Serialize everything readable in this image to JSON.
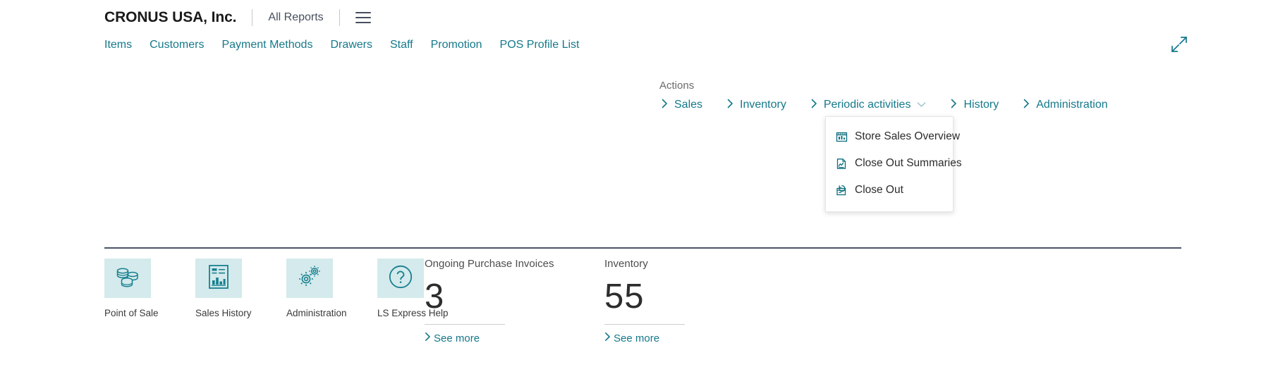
{
  "header": {
    "company": "CRONUS USA, Inc.",
    "all_reports": "All Reports",
    "menu_icon": "hamburger-icon"
  },
  "nav": {
    "links": [
      "Items",
      "Customers",
      "Payment Methods",
      "Drawers",
      "Staff",
      "Promotion",
      "POS Profile List"
    ],
    "expand_icon": "expand-diagonal-icon"
  },
  "actions": {
    "label": "Actions",
    "items": [
      {
        "label": "Sales",
        "has_caret": false
      },
      {
        "label": "Inventory",
        "has_caret": false
      },
      {
        "label": "Periodic activities",
        "has_caret": true
      },
      {
        "label": "History",
        "has_caret": false
      },
      {
        "label": "Administration",
        "has_caret": false
      }
    ]
  },
  "dropdown": {
    "open_for": "Periodic activities",
    "items": [
      {
        "label": "Store Sales Overview",
        "icon": "store-sales-overview-icon"
      },
      {
        "label": "Close Out Summaries",
        "icon": "close-out-summaries-icon"
      },
      {
        "label": "Close Out",
        "icon": "close-out-icon"
      }
    ]
  },
  "tiles": [
    {
      "label": "Point of Sale",
      "icon": "coins-icon"
    },
    {
      "label": "Sales History",
      "icon": "report-chart-icon"
    },
    {
      "label": "Administration",
      "icon": "gears-icon"
    },
    {
      "label": "LS Express Help",
      "icon": "question-circle-icon"
    }
  ],
  "kpis": [
    {
      "title": "Ongoing Purchase Invoices",
      "value": "3",
      "more": "See more"
    },
    {
      "title": "Inventory",
      "value": "55",
      "more": "See more"
    }
  ],
  "colors": {
    "link_teal": "#15798a",
    "tile_bg": "#d4eaec",
    "divider": "#49546a"
  }
}
